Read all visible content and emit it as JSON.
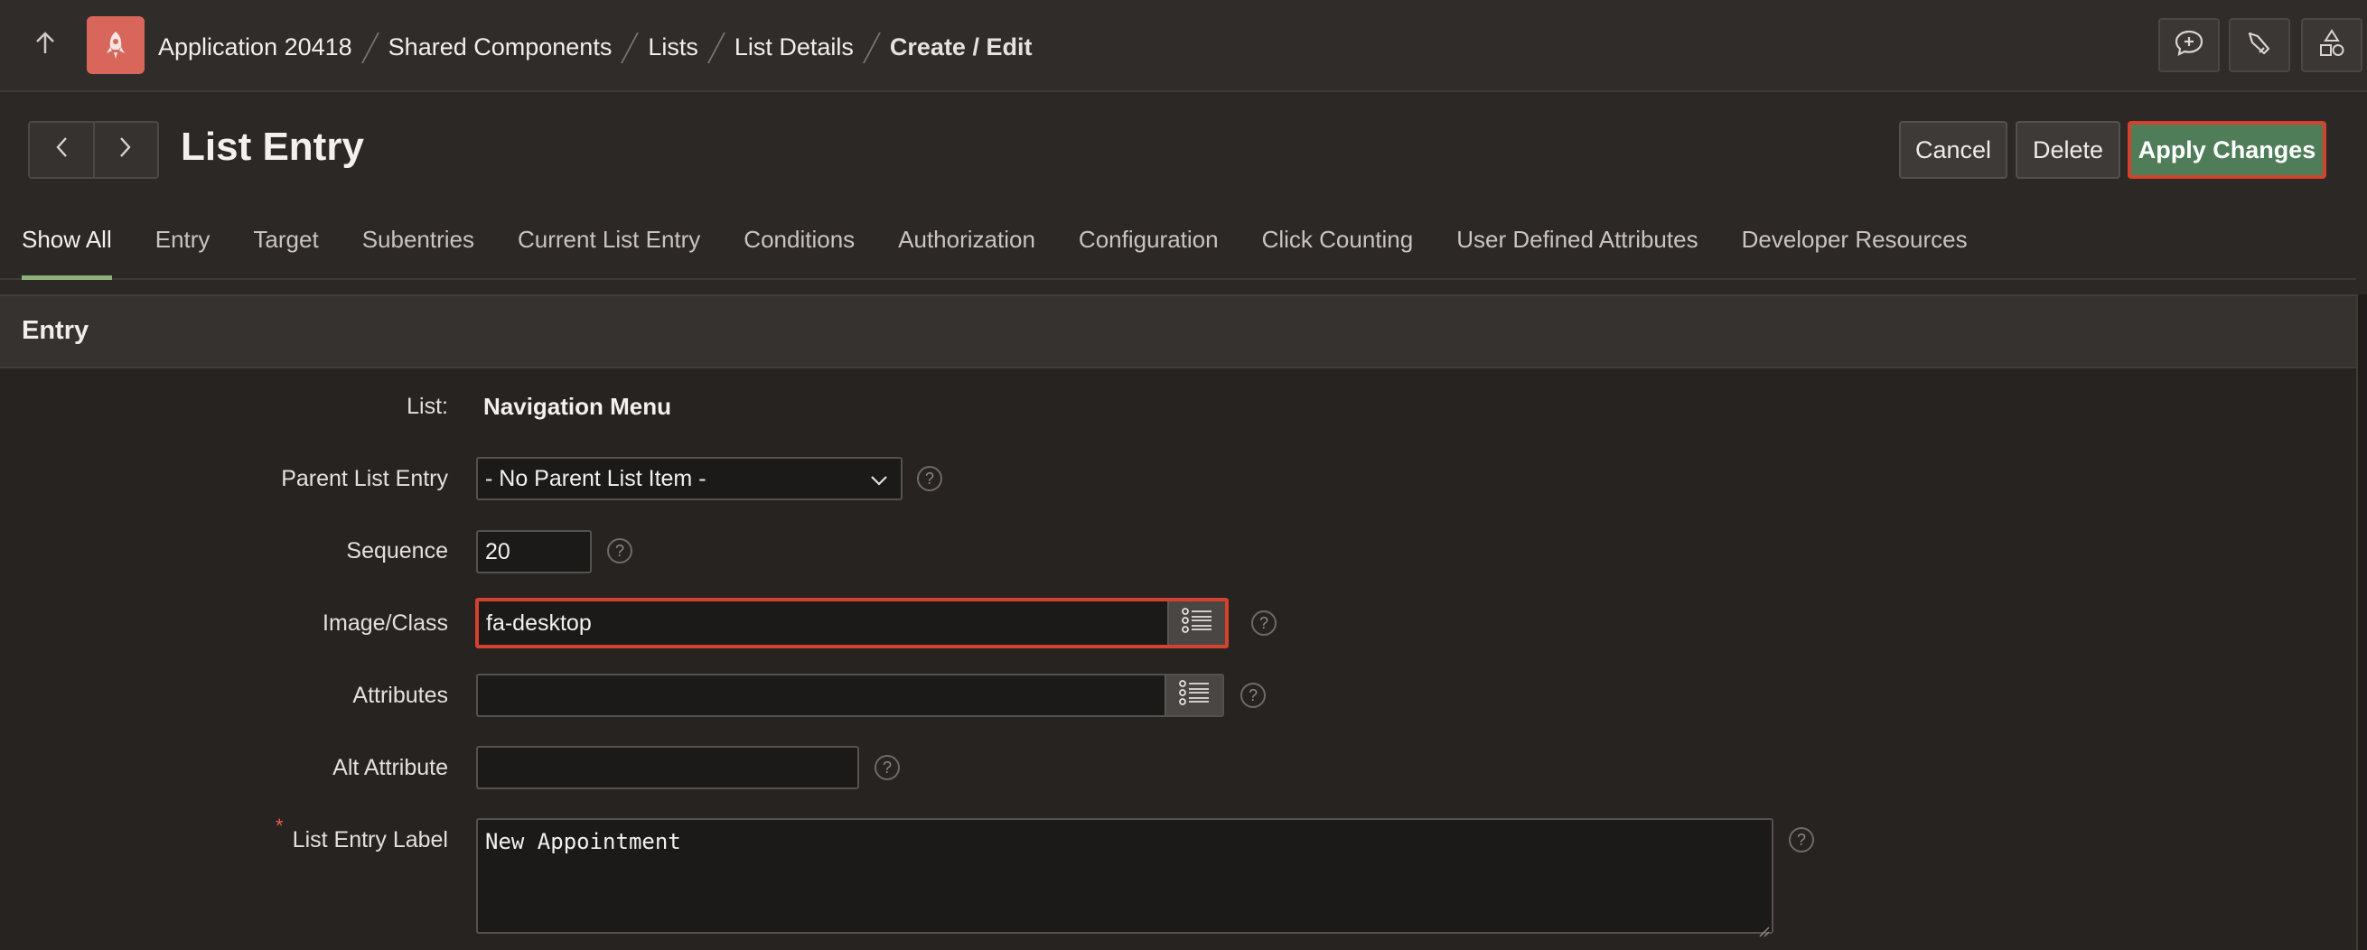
{
  "header": {
    "breadcrumbs": [
      {
        "label": "Application 20418"
      },
      {
        "label": "Shared Components"
      },
      {
        "label": "Lists"
      },
      {
        "label": "List Details"
      },
      {
        "label": "Create / Edit"
      }
    ]
  },
  "toolbar": {
    "title": "List Entry",
    "cancel_label": "Cancel",
    "delete_label": "Delete",
    "apply_label": "Apply Changes"
  },
  "tabs": [
    {
      "label": "Show All",
      "active": true
    },
    {
      "label": "Entry"
    },
    {
      "label": "Target"
    },
    {
      "label": "Subentries"
    },
    {
      "label": "Current List Entry"
    },
    {
      "label": "Conditions"
    },
    {
      "label": "Authorization"
    },
    {
      "label": "Configuration"
    },
    {
      "label": "Click Counting"
    },
    {
      "label": "User Defined Attributes"
    },
    {
      "label": "Developer Resources"
    }
  ],
  "region": {
    "title": "Entry",
    "fields": {
      "list": {
        "label": "List:",
        "value": "Navigation Menu"
      },
      "parent": {
        "label": "Parent List Entry",
        "value": "- No Parent List Item -"
      },
      "sequence": {
        "label": "Sequence",
        "value": "20"
      },
      "image_class": {
        "label": "Image/Class",
        "value": "fa-desktop"
      },
      "attributes": {
        "label": "Attributes",
        "value": ""
      },
      "alt_attribute": {
        "label": "Alt Attribute",
        "value": ""
      },
      "entry_label": {
        "label": "List Entry Label",
        "value": "New Appointment",
        "required_marker": "*"
      }
    },
    "help_glyph": "?"
  },
  "colors": {
    "primary_button": "#4e7d57",
    "highlight_border": "#d2422c",
    "app_logo": "#d9665b",
    "active_tab_underline": "#8cb17b"
  },
  "icons": [
    "arrow-up-icon",
    "app-logo-icon",
    "chat-add-icon",
    "broom-icon",
    "shapes-icon",
    "chevron-left-icon",
    "chevron-right-icon",
    "chevron-down-icon",
    "list-popup-icon",
    "help-icon"
  ]
}
